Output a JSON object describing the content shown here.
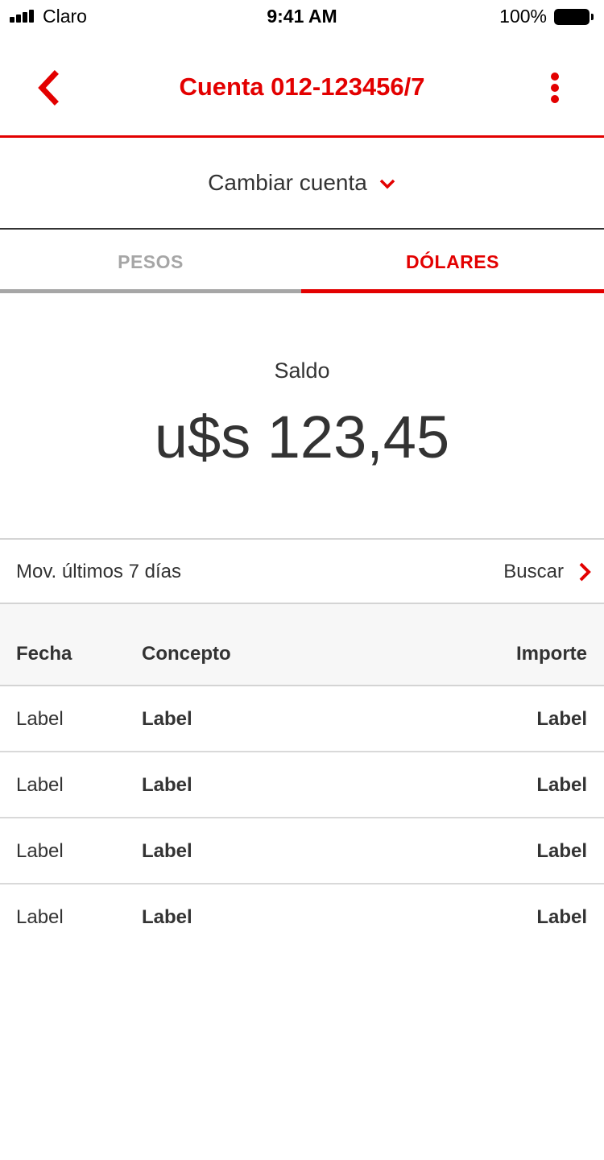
{
  "status_bar": {
    "carrier": "Claro",
    "time": "9:41 AM",
    "battery": "100%"
  },
  "header": {
    "title": "Cuenta 012-123456/7"
  },
  "account_switch": {
    "label": "Cambiar cuenta"
  },
  "tabs": [
    {
      "label": "PESOS",
      "active": false
    },
    {
      "label": "DÓLARES",
      "active": true
    }
  ],
  "balance": {
    "label": "Saldo",
    "value": "u$s 123,45"
  },
  "movements": {
    "title": "Mov. últimos 7 días",
    "search_label": "Buscar"
  },
  "table": {
    "headers": {
      "fecha": "Fecha",
      "concepto": "Concepto",
      "importe": "Importe"
    },
    "rows": [
      {
        "fecha": "Label",
        "concepto": "Label",
        "importe": "Label"
      },
      {
        "fecha": "Label",
        "concepto": "Label",
        "importe": "Label"
      },
      {
        "fecha": "Label",
        "concepto": "Label",
        "importe": "Label"
      },
      {
        "fecha": "Label",
        "concepto": "Label",
        "importe": "Label"
      }
    ]
  },
  "colors": {
    "accent": "#e30000",
    "text": "#333333",
    "inactive_tab": "#a6a6a6"
  }
}
